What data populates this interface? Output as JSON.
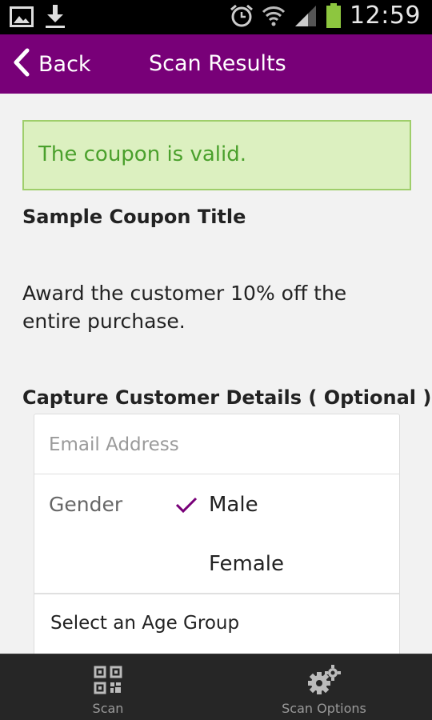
{
  "status_bar": {
    "time": "12:59",
    "icons": [
      "gallery-icon",
      "download-icon",
      "alarm-icon",
      "wifi-icon",
      "signal-icon",
      "battery-icon"
    ]
  },
  "action_bar": {
    "back_label": "Back",
    "title": "Scan Results",
    "background": "#780078"
  },
  "result": {
    "message": "The coupon is valid.",
    "status_color": "#4aa02c"
  },
  "coupon": {
    "title": "Sample Coupon Title",
    "description": "Award the customer 10% off the entire purchase."
  },
  "capture": {
    "heading": "Capture Customer Details ( Optional )",
    "email_placeholder": "Email Address",
    "email_value": "",
    "gender_label": "Gender",
    "gender_options": [
      {
        "label": "Male",
        "selected": true
      },
      {
        "label": "Female",
        "selected": false
      }
    ],
    "age_group_placeholder": "Select an Age Group"
  },
  "bottom_nav": {
    "items": [
      {
        "label": "Scan",
        "icon": "qr-code-icon"
      },
      {
        "label": "Scan Options",
        "icon": "gears-icon"
      }
    ]
  }
}
